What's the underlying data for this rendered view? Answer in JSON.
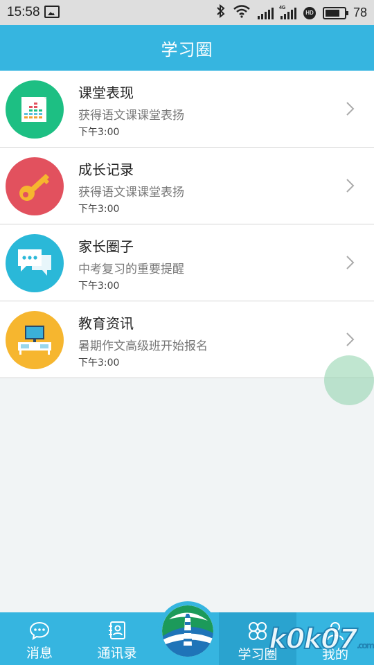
{
  "status_bar": {
    "time": "15:58",
    "network": "4G",
    "hd": "HD",
    "battery": "78",
    "battery_level": 0.78
  },
  "header": {
    "title": "学习圈"
  },
  "items": [
    {
      "title": "课堂表现",
      "subtitle": "获得语文课课堂表扬",
      "time": "下午3:00",
      "icon": "bar-chart-icon",
      "color": "#1dbf83"
    },
    {
      "title": "成长记录",
      "subtitle": "获得语文课课堂表扬",
      "time": "下午3:00",
      "icon": "key-icon",
      "color": "#e2515e"
    },
    {
      "title": "家长圈子",
      "subtitle": "中考复习的重要提醒",
      "time": "下午3:00",
      "icon": "chat-bubbles-icon",
      "color": "#2ab8d8"
    },
    {
      "title": "教育资讯",
      "subtitle": "暑期作文高级班开始报名",
      "time": "下午3:00",
      "icon": "monitor-icon",
      "color": "#f6b62f"
    }
  ],
  "tabs": [
    {
      "label": "消息",
      "icon": "message-icon"
    },
    {
      "label": "通讯录",
      "icon": "contacts-icon"
    },
    {
      "label": "学习圈",
      "icon": "clover-icon",
      "active": true
    },
    {
      "label": "我的",
      "icon": "person-icon"
    }
  ],
  "watermark": {
    "text": "k0k07",
    "suffix": ".com"
  },
  "colors": {
    "primary": "#36b5e0",
    "active_tab": "#2aa3cf",
    "background": "#f1f4f5"
  }
}
